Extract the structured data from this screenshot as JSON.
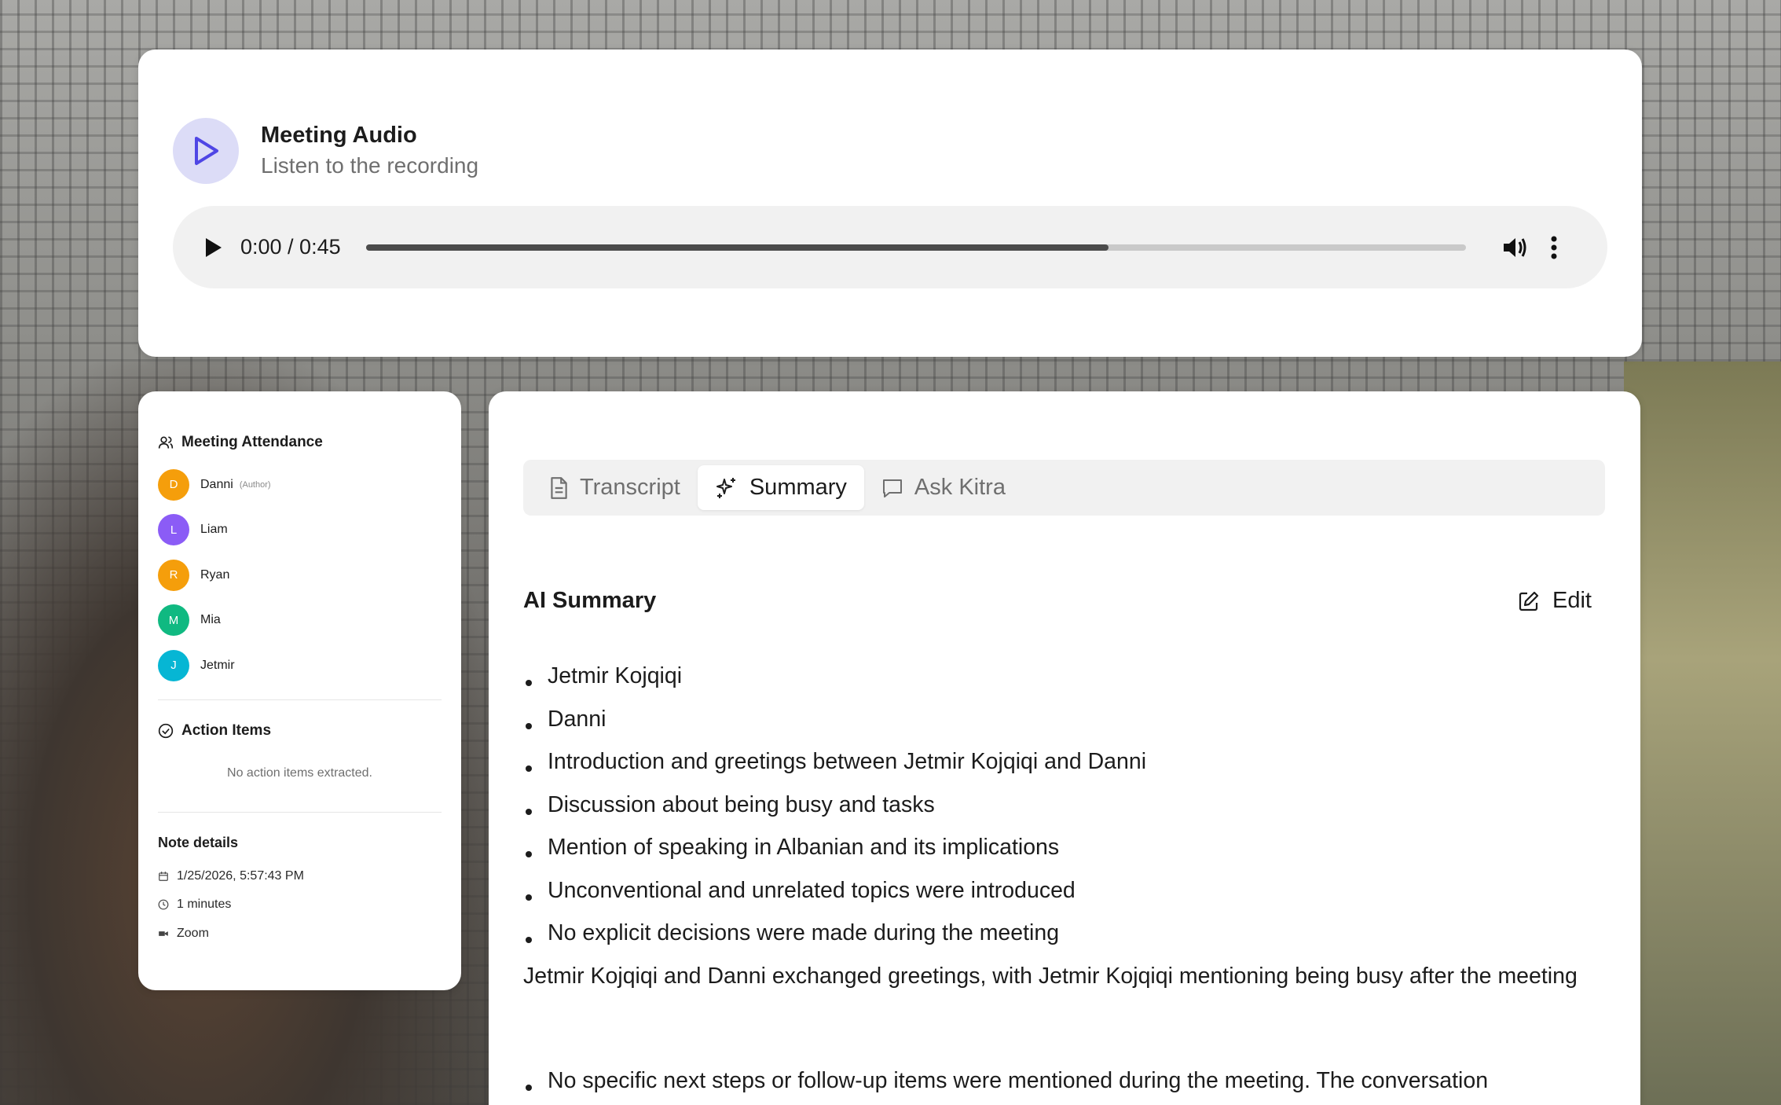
{
  "audio": {
    "title": "Meeting Audio",
    "subtitle": "Listen to the recording",
    "time": "0:00 / 0:45",
    "progress": 0.675,
    "accent": "#dcdcf7",
    "icon_color": "#4f46e5"
  },
  "attendance": {
    "title": "Meeting Attendance",
    "people": [
      {
        "initial": "D",
        "name": "Danni",
        "role": "(Author)",
        "color": "#f59e0b"
      },
      {
        "initial": "L",
        "name": "Liam",
        "role": "",
        "color": "#8b5cf6"
      },
      {
        "initial": "R",
        "name": "Ryan",
        "role": "",
        "color": "#f59e0b"
      },
      {
        "initial": "M",
        "name": "Mia",
        "role": "",
        "color": "#10b981"
      },
      {
        "initial": "J",
        "name": "Jetmir",
        "role": "",
        "color": "#06b6d4"
      }
    ]
  },
  "action_items": {
    "title": "Action Items",
    "empty": "No action items extracted."
  },
  "note_details": {
    "title": "Note details",
    "date": "1/25/2026, 5:57:43 PM",
    "duration": "1 minutes",
    "platform": "Zoom"
  },
  "tabs": [
    {
      "label": "Transcript",
      "icon": "document-icon",
      "active": false
    },
    {
      "label": "Summary",
      "icon": "sparkles-icon",
      "active": true
    },
    {
      "label": "Ask Kitra",
      "icon": "chat-icon",
      "active": false
    }
  ],
  "summary": {
    "title": "AI Summary",
    "edit_label": "Edit",
    "bullets": [
      "Jetmir Kojqiqi",
      "Danni",
      "Introduction and greetings between Jetmir Kojqiqi and Danni",
      "Discussion about being busy and tasks",
      "Mention of speaking in Albanian and its implications",
      "Unconventional and unrelated topics were introduced",
      "No explicit decisions were made during the meeting"
    ],
    "paragraph": "Jetmir Kojqiqi and Danni exchanged greetings, with Jetmir Kojqiqi mentioning being busy after the meeting",
    "bullets2": [
      "No specific next steps or follow-up items were mentioned during the meeting. The conversation"
    ]
  }
}
